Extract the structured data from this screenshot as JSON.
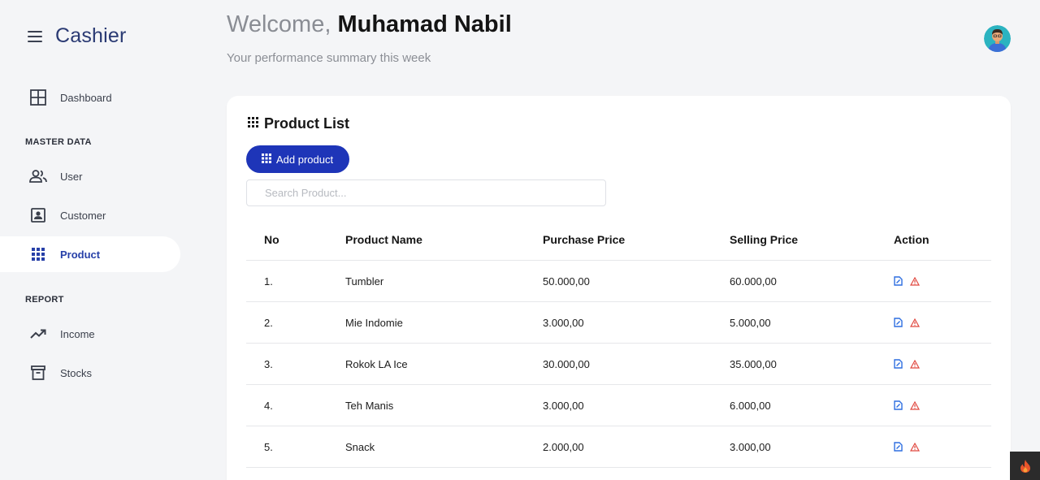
{
  "app": {
    "title": "Cashier"
  },
  "header": {
    "welcome_prefix": "Welcome,",
    "user_name": "Muhamad Nabil",
    "subtitle": "Your performance summary this week"
  },
  "sidebar": {
    "items": [
      {
        "label": "Dashboard",
        "icon": "dashboard-icon"
      },
      {
        "label": "User",
        "icon": "users-icon"
      },
      {
        "label": "Customer",
        "icon": "customer-icon"
      },
      {
        "label": "Product",
        "icon": "grid-icon",
        "active": true
      },
      {
        "label": "Income",
        "icon": "trending-up-icon"
      },
      {
        "label": "Stocks",
        "icon": "archive-icon"
      }
    ],
    "sections": {
      "master": "MASTER DATA",
      "report": "REPORT"
    }
  },
  "card": {
    "title": "Product List",
    "add_label": "Add product",
    "search_placeholder": "Search Product..."
  },
  "table": {
    "headers": [
      "No",
      "Product Name",
      "Purchase Price",
      "Selling Price",
      "Action"
    ],
    "rows": [
      [
        "1.",
        "Tumbler",
        "50.000,00",
        "60.000,00"
      ],
      [
        "2.",
        "Mie Indomie",
        "3.000,00",
        "5.000,00"
      ],
      [
        "3.",
        "Rokok LA Ice",
        "30.000,00",
        "35.000,00"
      ],
      [
        "4.",
        "Teh Manis",
        "3.000,00",
        "6.000,00"
      ],
      [
        "5.",
        "Snack",
        "2.000,00",
        "3.000,00"
      ]
    ]
  },
  "colors": {
    "accent": "#1e35b8",
    "active_text": "#2740a8",
    "edit_icon": "#2f6fe0",
    "delete_icon": "#e0473f"
  }
}
